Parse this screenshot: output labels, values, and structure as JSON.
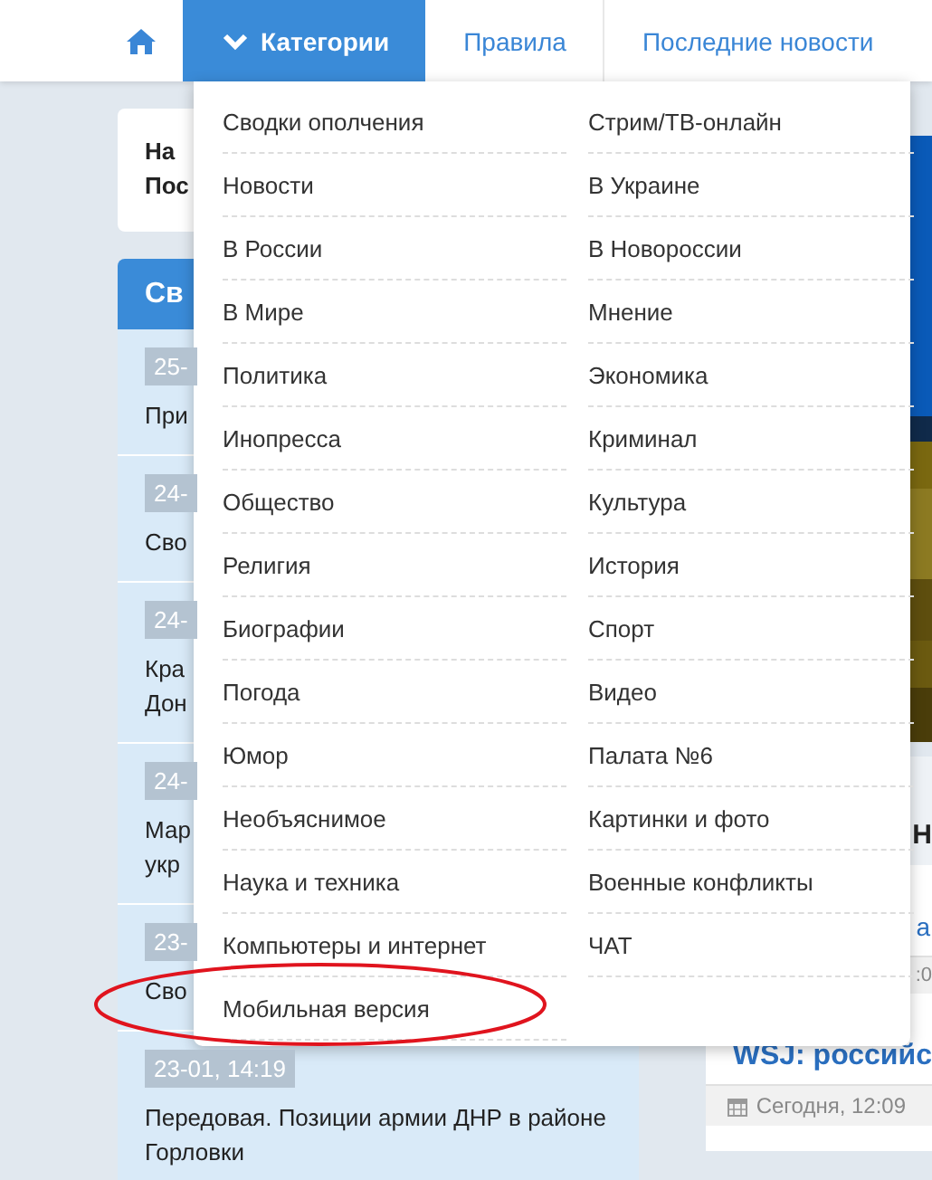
{
  "nav": {
    "items": [
      {
        "kind": "home",
        "selected": false
      },
      {
        "kind": "dropdown",
        "label": "Категории",
        "selected": true
      },
      {
        "kind": "link",
        "label": "Правила",
        "selected": false
      },
      {
        "kind": "link",
        "label": "Последние новости",
        "selected": false
      }
    ]
  },
  "notice": {
    "lines": [
      "На",
      "Пос"
    ]
  },
  "sidebar": {
    "title": "Св",
    "items": [
      {
        "date": "25-",
        "title": [
          "При"
        ]
      },
      {
        "date": "24-",
        "title": [
          "Сво"
        ]
      },
      {
        "date": "24-",
        "title": [
          "Кра",
          "Дон"
        ]
      },
      {
        "date": "24-",
        "title": [
          "Мар",
          "укр"
        ]
      },
      {
        "date": "23-",
        "title": [
          "Сво"
        ]
      },
      {
        "date": "23-01, 14:19",
        "title": [
          "Передовая. Позиции армии ДНР в районе Горловки"
        ]
      }
    ]
  },
  "right": {
    "heading": "Н",
    "link": "а",
    "date": ":0",
    "article": {
      "title": "WSJ: российс",
      "date": "Сегодня, 12:09"
    }
  },
  "menu": {
    "columns": [
      [
        "Сводки ополчения",
        "Новости",
        "В России",
        "В Мире",
        "Политика",
        "Инопресса",
        "Общество",
        "Религия",
        "Биографии",
        "Погода",
        "Юмор",
        "Необъяснимое",
        "Наука и техника",
        "Компьютеры и интернет",
        "Мобильная версия"
      ],
      [
        "Стрим/ТВ-онлайн",
        "В Украине",
        "В Новороссии",
        "Мнение",
        "Экономика",
        "Криминал",
        "Культура",
        "История",
        "Спорт",
        "Видео",
        "Палата №6",
        "Картинки и фото",
        "Военные конфликты",
        "ЧАТ"
      ]
    ]
  },
  "annotation": {
    "kind": "ellipse",
    "color": "#e0141e"
  }
}
